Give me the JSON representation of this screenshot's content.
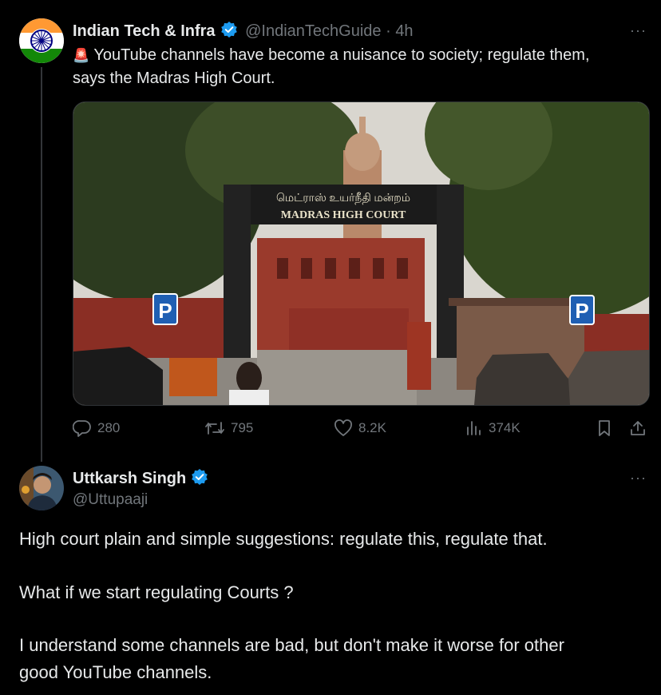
{
  "tweet": {
    "author_name": "Indian Tech & Infra",
    "handle": "@IndianTechGuide",
    "time": "4h",
    "siren_emoji": "🚨",
    "text_line1": "YouTube channels have become a nuisance to society; regulate them,",
    "text_line2": "says the Madras High Court.",
    "image_sign_tamil": "மெட்ராஸ் உயர்நீதி மன்றம்",
    "image_sign_english": "MADRAS HIGH COURT",
    "image_parking_sign": "P",
    "stats": {
      "replies": "280",
      "retweets": "795",
      "likes": "8.2K",
      "views": "374K"
    }
  },
  "reply": {
    "author_name": "Uttkarsh Singh",
    "handle": "@Uttupaaji",
    "paragraph1": "High court plain and simple suggestions: regulate this, regulate that.",
    "paragraph2": "What if we start regulating Courts ?",
    "paragraph3_line1": "I understand some channels are bad, but don't make it worse for other",
    "paragraph3_line2": "good YouTube channels."
  },
  "more_label": "···",
  "icons": [
    "more-icon",
    "verified-icon",
    "reply-icon",
    "retweet-icon",
    "like-icon",
    "views-icon",
    "bookmark-icon",
    "share-icon"
  ],
  "colors": {
    "background": "#000000",
    "text": "#e7e9ea",
    "muted": "#71767b",
    "verified": "#1d9bf0"
  }
}
